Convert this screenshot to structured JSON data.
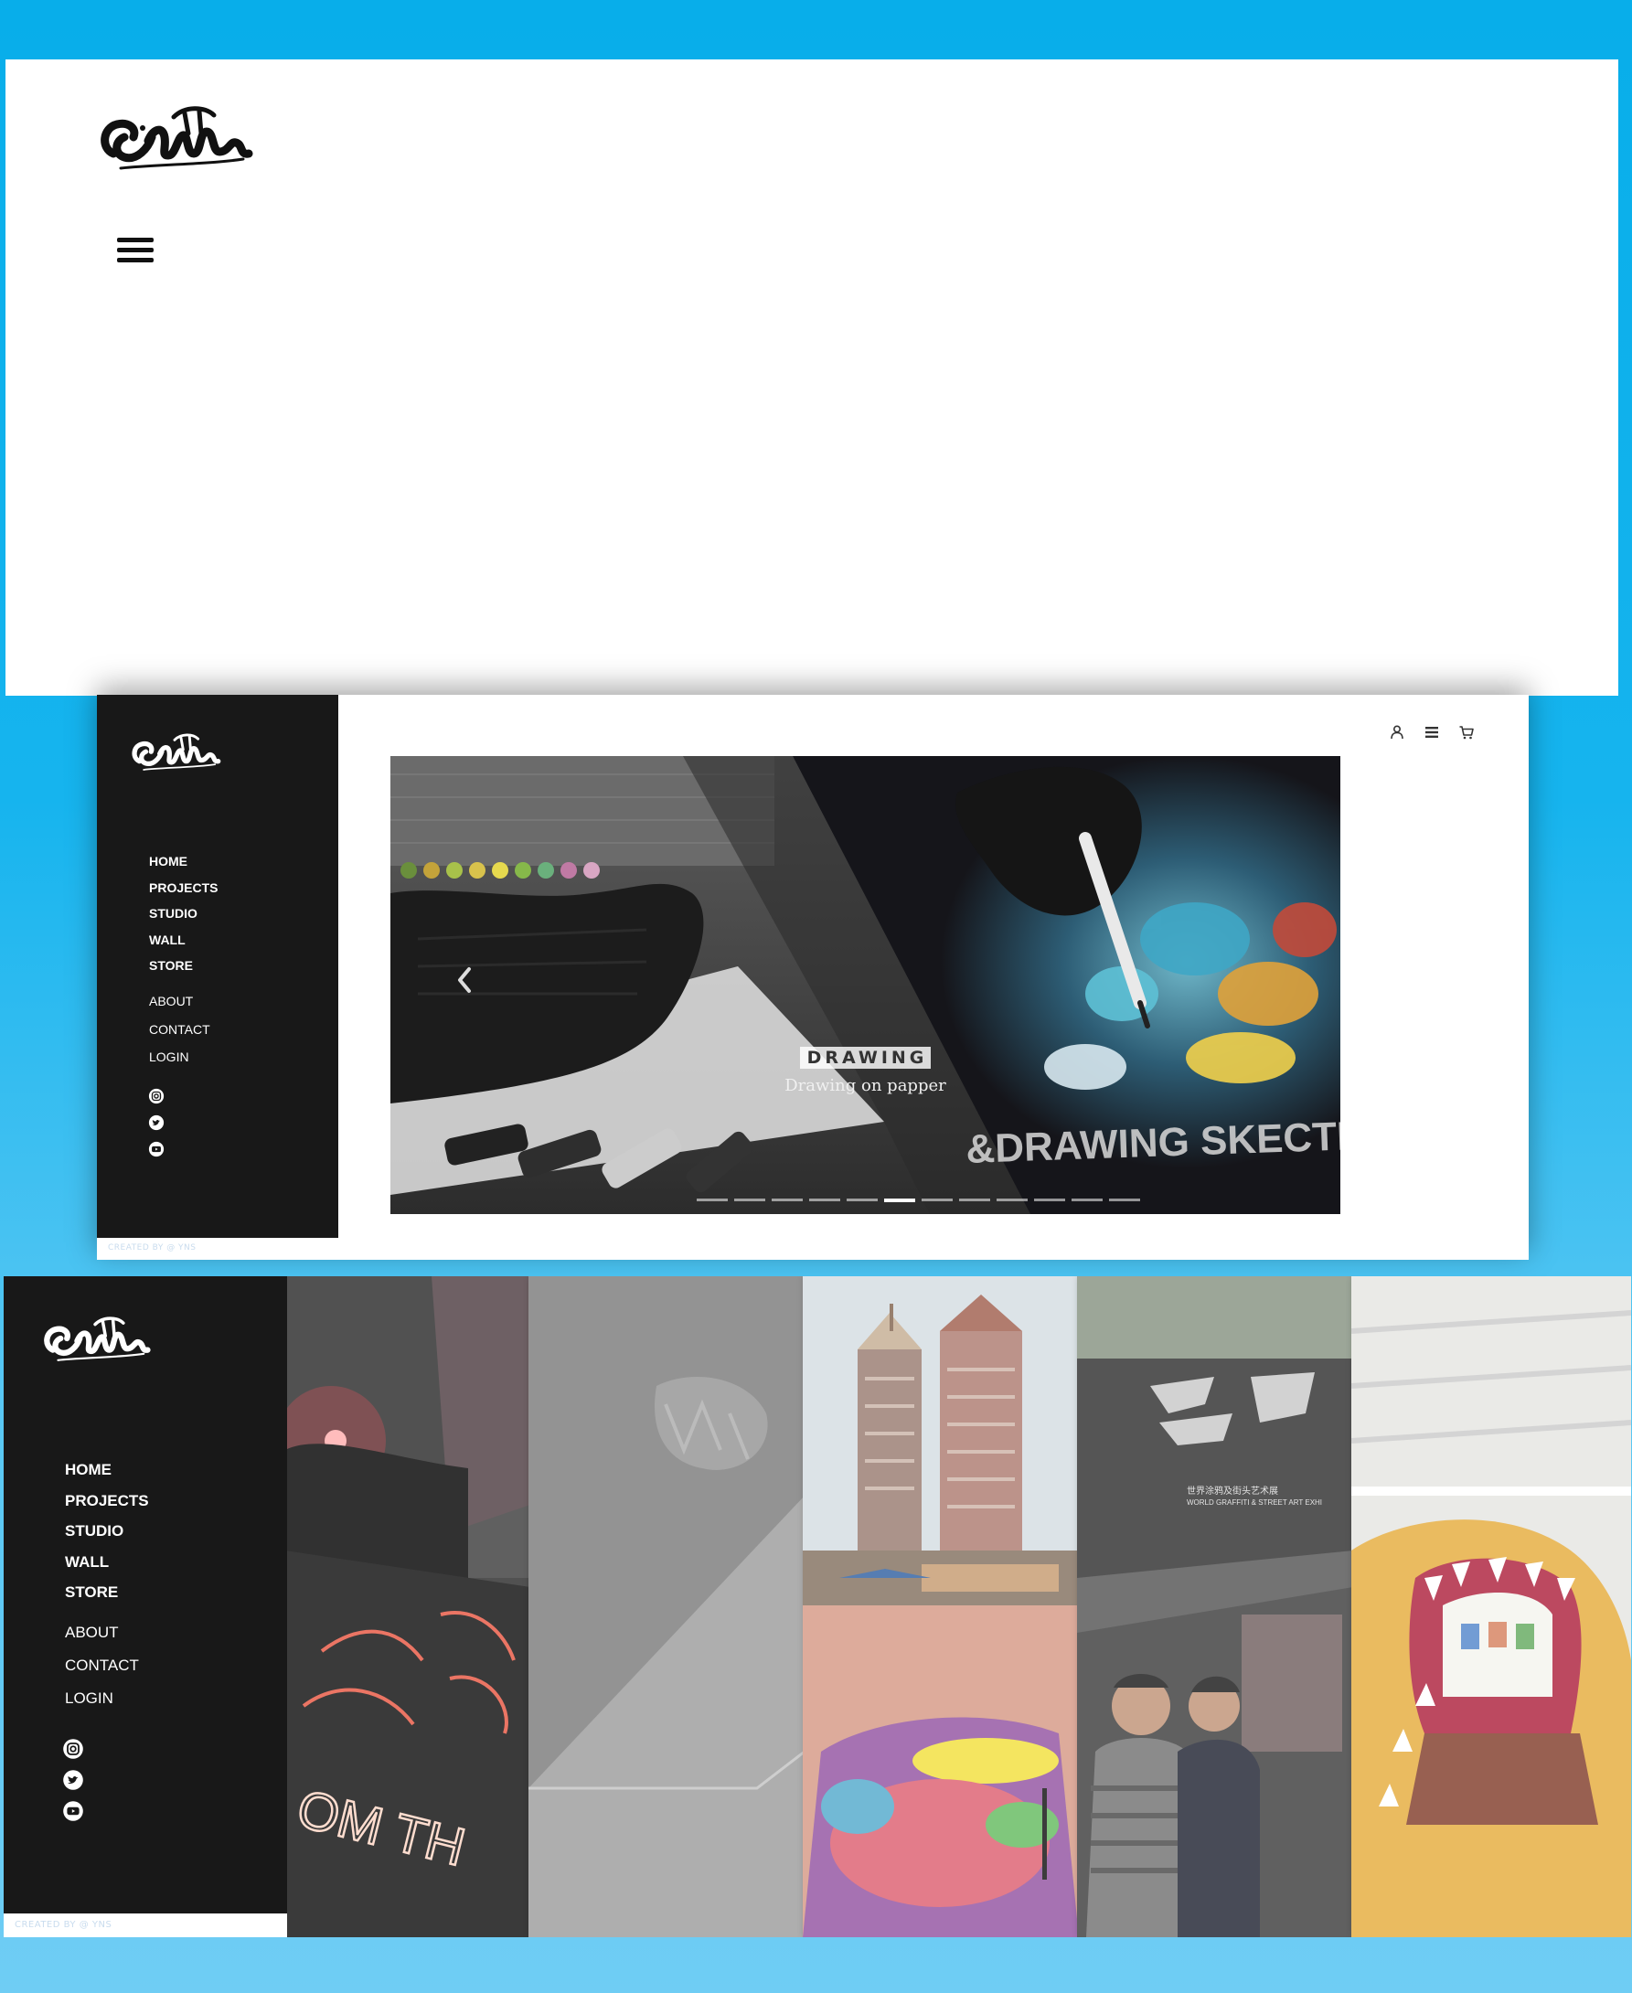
{
  "brand": {
    "logo_alt": "Gmak graffiti tag logo"
  },
  "mobile": {
    "menu_icon": "hamburger-menu-icon"
  },
  "desktop_slider": {
    "sidebar": {
      "main_nav": [
        "HOME",
        "PROJECTS",
        "STUDIO",
        "WALL",
        "STORE"
      ],
      "secondary_nav": [
        "ABOUT",
        "CONTACT",
        "LOGIN"
      ],
      "socials": [
        "instagram-icon",
        "twitter-icon",
        "youtube-icon"
      ],
      "credit": "CREATED BY @ YNS"
    },
    "top_icons": [
      "user-icon",
      "menu-icon",
      "cart-icon"
    ],
    "slide": {
      "title": "DRAWING",
      "subtitle": "Drawing on papper",
      "watermark": "&DRAWING SKECTH"
    },
    "slide_count": 12,
    "active_slide": 6
  },
  "desktop_gallery": {
    "sidebar": {
      "main_nav": [
        "HOME",
        "PROJECTS",
        "STUDIO",
        "WALL",
        "STORE"
      ],
      "secondary_nav": [
        "ABOUT",
        "CONTACT",
        "LOGIN"
      ],
      "socials": [
        "instagram-icon",
        "twitter-icon",
        "youtube-icon"
      ],
      "credit": "CREATED BY @ YNS"
    },
    "tiles": [
      {
        "name": "neon-studio",
        "text": "OM TH"
      },
      {
        "name": "paper-emboss",
        "text": ""
      },
      {
        "name": "street-mural",
        "text": ""
      },
      {
        "name": "graffiti-exhibition",
        "text": "WORLD GRAFFITI & STREET ART EXHI",
        "sub_text": "世界涂鸦及街头艺术展"
      },
      {
        "name": "dinosaur-gallery",
        "text": ""
      }
    ]
  },
  "colors": {
    "background": "#08aeea",
    "sidebar": "#181818",
    "text_on_dark": "#ffffff"
  }
}
